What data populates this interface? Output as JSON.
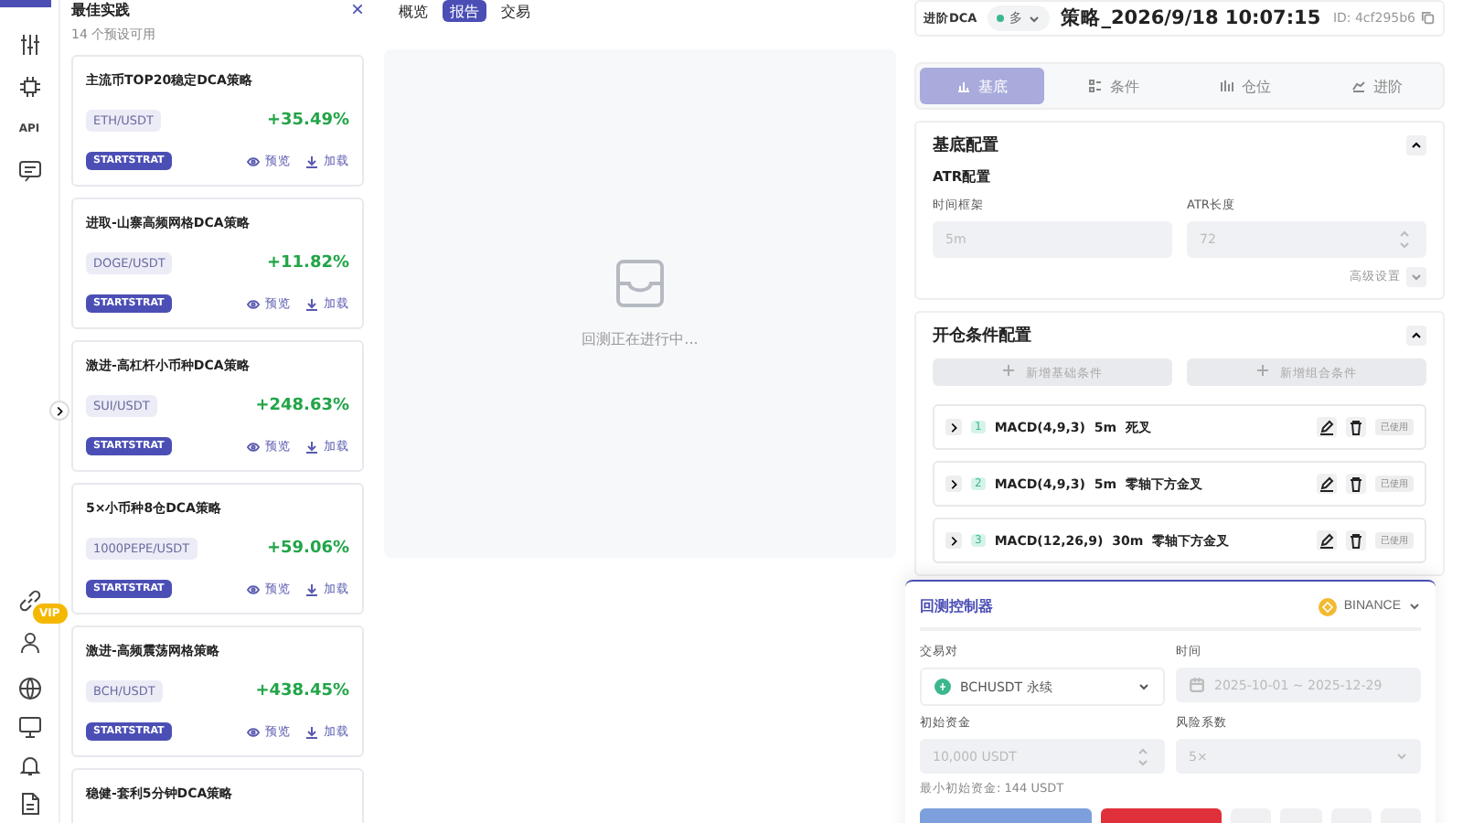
{
  "rail": {
    "api_label": "API",
    "vip": "VIP"
  },
  "presets": {
    "title": "最佳实践",
    "subtitle": "14 个预设可用",
    "close": "×",
    "cards": [
      {
        "title": "主流币TOP20稳定DCA策略",
        "pair": "ETH/USDT",
        "gain": "+35.49%",
        "tag": "STARTSTRAT",
        "preview": "预览",
        "load": "加载"
      },
      {
        "title": "进取-山寨高频网格DCA策略",
        "pair": "DOGE/USDT",
        "gain": "+11.82%",
        "tag": "STARTSTRAT",
        "preview": "预览",
        "load": "加载"
      },
      {
        "title": "激进-高杠杆小币种DCA策略",
        "pair": "SUI/USDT",
        "gain": "+248.63%",
        "tag": "STARTSTRAT",
        "preview": "预览",
        "load": "加载"
      },
      {
        "title": "5×小币种8仓DCA策略",
        "pair": "1000PEPE/USDT",
        "gain": "+59.06%",
        "tag": "STARTSTRAT",
        "preview": "预览",
        "load": "加载"
      },
      {
        "title": "激进-高频震荡网格策略",
        "pair": "BCH/USDT",
        "gain": "+438.45%",
        "tag": "STARTSTRAT",
        "preview": "预览",
        "load": "加载"
      },
      {
        "title": "稳健-套利5分钟DCA策略"
      }
    ]
  },
  "report": {
    "tabs": [
      {
        "label": "概览",
        "selected": false
      },
      {
        "label": "报告",
        "selected": true
      },
      {
        "label": "交易",
        "selected": false
      }
    ],
    "empty_text": "回测正在进行中..."
  },
  "strategy": {
    "type": "进阶DCA",
    "direction": "多",
    "title": "策略_2026/9/18 10:07:15",
    "id": "ID: 4cf295b6",
    "tabs": [
      {
        "label": "基底",
        "selected": true
      },
      {
        "label": "条件",
        "selected": false
      },
      {
        "label": "仓位",
        "selected": false
      },
      {
        "label": "进阶",
        "selected": false
      }
    ],
    "base": {
      "title": "基底配置",
      "subtitle": "ATR配置",
      "fields": [
        {
          "label": "时间框架",
          "value": "5m",
          "kind": "text",
          "disabled": true
        },
        {
          "label": "ATR长度",
          "value": "72",
          "kind": "number",
          "disabled": true
        }
      ],
      "advanced": "高级设置"
    },
    "open": {
      "title": "开仓条件配置",
      "add_buttons": [
        "新增基础条件",
        "新增组合条件"
      ],
      "conditions": [
        {
          "index": "1",
          "text": "MACD(4,9,3)  5m  死叉",
          "status": "已使用"
        },
        {
          "index": "2",
          "text": "MACD(4,9,3)  5m  零轴下方金叉",
          "status": "已使用"
        },
        {
          "index": "3",
          "text": "MACD(12,26,9)  30m  零轴下方金叉",
          "status": "已使用"
        }
      ]
    }
  },
  "controller": {
    "title": "回测控制器",
    "exchange": "BINANCE",
    "fields": [
      {
        "label": "交易对",
        "value": "BCHUSDT 永续",
        "kind": "pair",
        "disabled": false
      },
      {
        "label": "时间",
        "value": "2025-10-01 ~ 2025-12-29",
        "kind": "date",
        "disabled": true
      },
      {
        "label": "初始资金",
        "value": "10,000 USDT",
        "kind": "number",
        "disabled": true
      },
      {
        "label": "风险系数",
        "value": "5×",
        "kind": "select",
        "disabled": true
      }
    ],
    "hint": "最小初始资金: 144 USDT",
    "buttons": [
      {
        "kind": "primary"
      },
      {
        "kind": "danger"
      },
      {
        "kind": "icon"
      },
      {
        "kind": "icon"
      },
      {
        "kind": "icon"
      },
      {
        "kind": "icon"
      }
    ]
  }
}
